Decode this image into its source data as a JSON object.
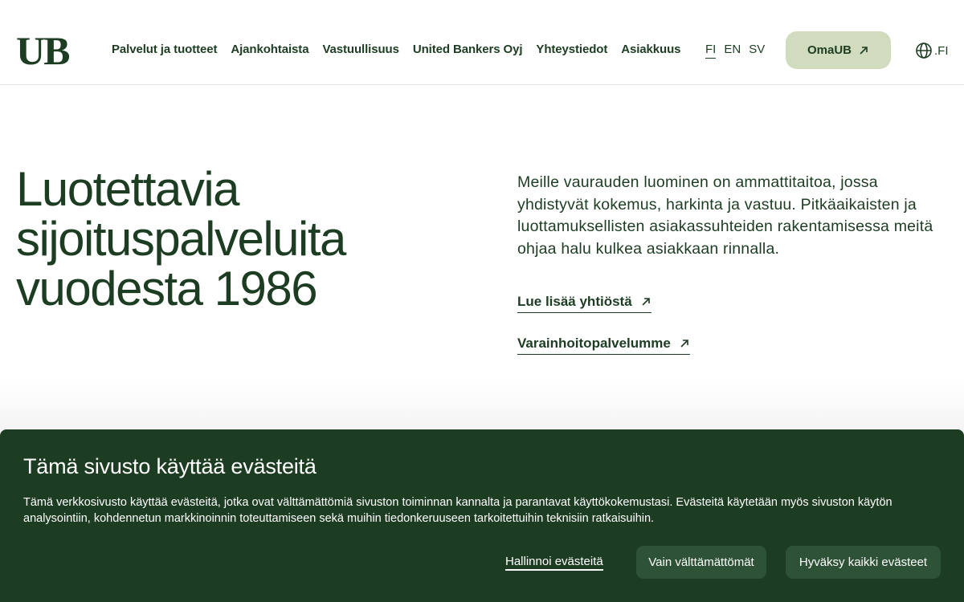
{
  "header": {
    "logo": "UB",
    "nav": [
      "Palvelut ja tuotteet",
      "Ajankohtaista",
      "Vastuullisuus",
      "United Bankers Oyj",
      "Yhteystiedot",
      "Asiakkuus"
    ],
    "languages": [
      "FI",
      "EN",
      "SV"
    ],
    "active_language": "FI",
    "omaub_label": "OmaUB",
    "region_label": ".FI"
  },
  "hero": {
    "title_lines": [
      "Luotettavia",
      "sijoituspalveluita",
      "vuodesta 1986"
    ],
    "intro": "Meille vaurauden luominen on ammattitaitoa, jossa yhdistyvät kokemus, harkinta ja vastuu. Pitkäaikaisten ja luottamuksellisten asiakassuhteiden rakentamisessa meitä ohjaa halu kulkea asiakkaan rinnalla.",
    "link_company": "Lue lisää yhtiöstä",
    "link_services": "Varainhoitopalvelumme"
  },
  "cookie": {
    "title": "Tämä sivusto käyttää evästeitä",
    "text": "Tämä verkkosivusto käyttää evästeitä, jotka ovat välttämättömiä sivuston toiminnan kannalta ja parantavat käyttökokemustasi. Evästeitä käytetään myös sivuston käytön analysointiin, kohdennetun markkinoinnin toteuttamiseen sekä muihin tiedonkeruuseen tarkoitettuihin teknisiin ratkaisuihin.",
    "manage_label": "Hallinnoi evästeitä",
    "essential_label": "Vain välttämättömät",
    "accept_label": "Hyväksy kaikki evästeet"
  },
  "colors": {
    "brand_green": "#1d3d23",
    "omaub_bg": "#d0dcbd",
    "cookie_button_bg": "#2e5235"
  },
  "icons": [
    "arrow-up-right-icon",
    "globe-icon"
  ]
}
